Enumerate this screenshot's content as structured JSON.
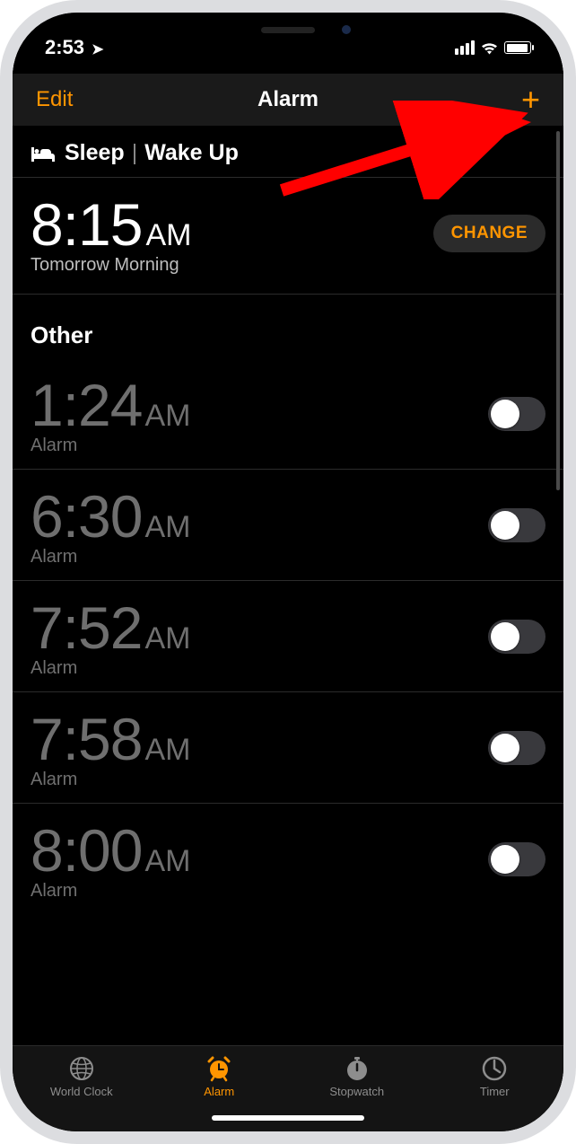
{
  "statusbar": {
    "time": "2:53"
  },
  "nav": {
    "edit": "Edit",
    "title": "Alarm",
    "add": "+"
  },
  "sleep": {
    "header_left": "Sleep",
    "header_right": "Wake Up",
    "time": "8:15",
    "ampm": "AM",
    "subtitle": "Tomorrow Morning",
    "change": "CHANGE"
  },
  "other_header": "Other",
  "alarms": [
    {
      "time": "1:24",
      "ampm": "AM",
      "label": "Alarm",
      "on": false
    },
    {
      "time": "6:30",
      "ampm": "AM",
      "label": "Alarm",
      "on": false
    },
    {
      "time": "7:52",
      "ampm": "AM",
      "label": "Alarm",
      "on": false
    },
    {
      "time": "7:58",
      "ampm": "AM",
      "label": "Alarm",
      "on": false
    },
    {
      "time": "8:00",
      "ampm": "AM",
      "label": "Alarm",
      "on": false
    }
  ],
  "tabs": {
    "world_clock": "World Clock",
    "alarm": "Alarm",
    "stopwatch": "Stopwatch",
    "timer": "Timer",
    "active": "alarm"
  }
}
